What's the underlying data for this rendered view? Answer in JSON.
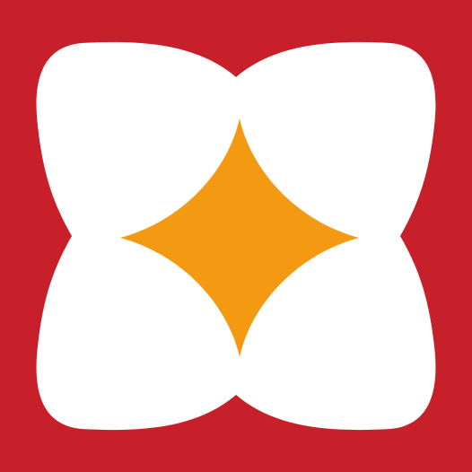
{
  "logo": {
    "icon": "four-petal-flower-with-four-point-star",
    "colors": {
      "background": "#C8202A",
      "petals": "#FFFFFF",
      "star": "#F39A12"
    }
  }
}
